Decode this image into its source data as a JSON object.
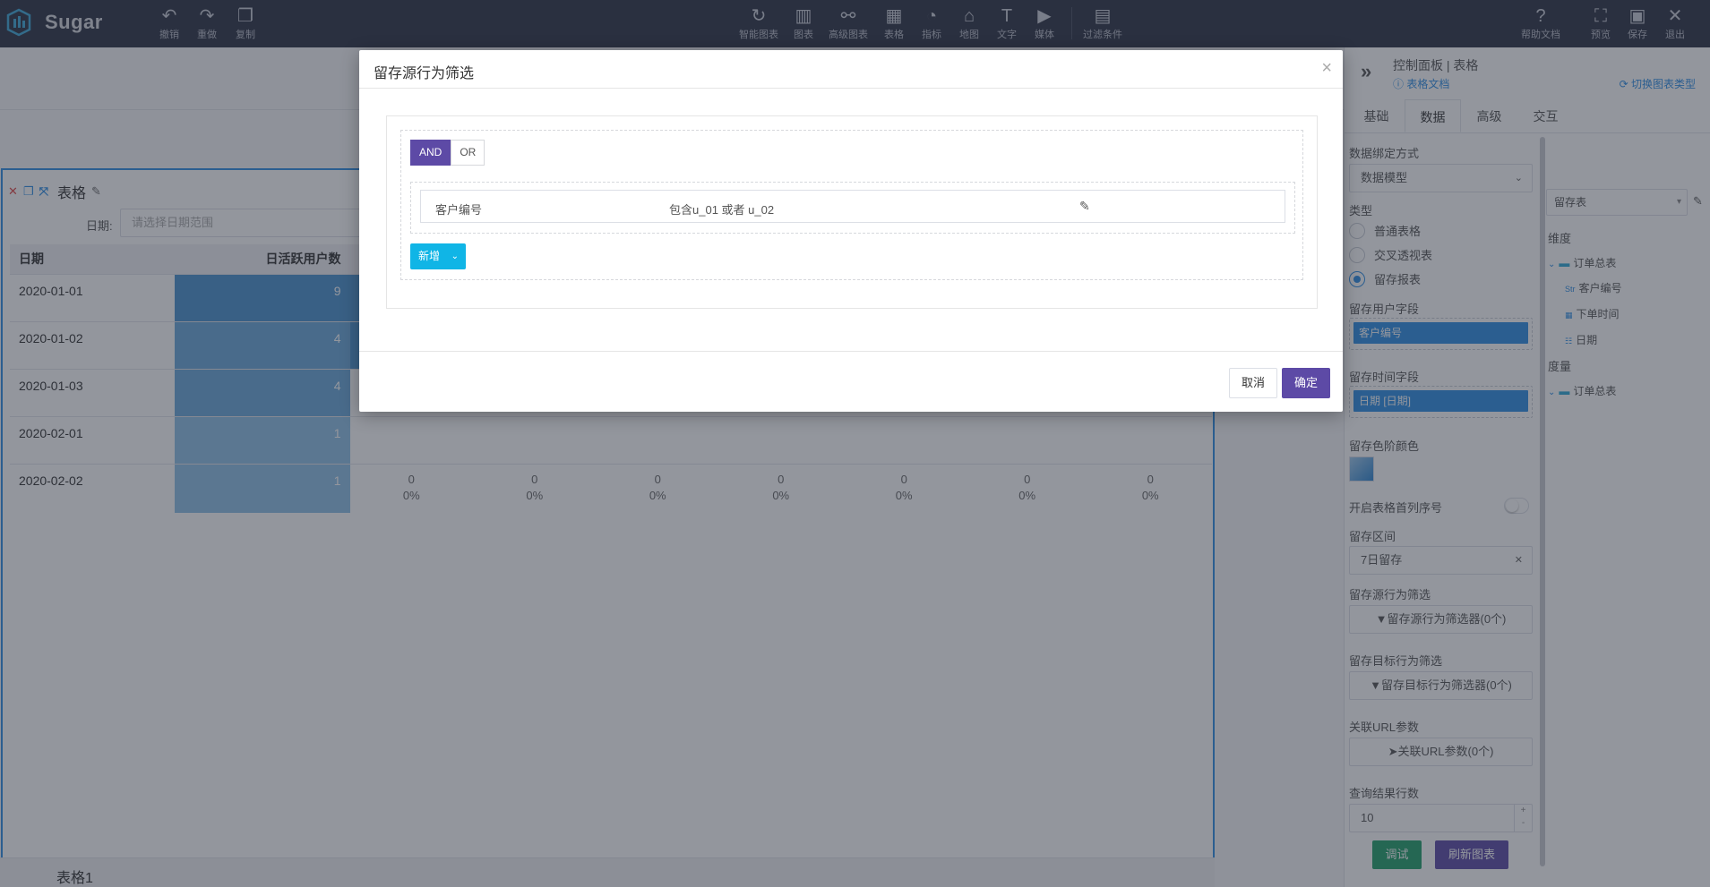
{
  "app": {
    "brand": "Sugar"
  },
  "toolbar": {
    "left": [
      {
        "label": "撤销",
        "icon": "undo-icon"
      },
      {
        "label": "重做",
        "icon": "redo-icon"
      },
      {
        "label": "复制",
        "icon": "copy-icon"
      }
    ],
    "center": [
      {
        "label": "智能图表",
        "icon": "smart-chart-icon"
      },
      {
        "label": "图表",
        "icon": "bar-chart-icon"
      },
      {
        "label": "高级图表",
        "icon": "advanced-chart-icon"
      },
      {
        "label": "表格",
        "icon": "table-icon"
      },
      {
        "label": "指标",
        "icon": "gauge-icon"
      },
      {
        "label": "地图",
        "icon": "map-icon"
      },
      {
        "label": "文字",
        "icon": "text-icon"
      },
      {
        "label": "媒体",
        "icon": "media-icon"
      },
      {
        "label": "过滤条件",
        "icon": "filter-icon"
      }
    ],
    "right": [
      {
        "label": "帮助文档",
        "icon": "help-icon"
      },
      {
        "label": "预览",
        "icon": "preview-icon"
      },
      {
        "label": "保存",
        "icon": "save-icon"
      },
      {
        "label": "退出",
        "icon": "exit-icon"
      }
    ]
  },
  "widget": {
    "title": "表格",
    "date_label": "日期:",
    "date_placeholder": "请选择日期范围",
    "columns": [
      "日期",
      "日活跃用户数"
    ],
    "rows": [
      {
        "date": "2020-01-01",
        "value": "9"
      },
      {
        "date": "2020-01-02",
        "value": "4"
      },
      {
        "date": "2020-01-03",
        "value": "4"
      },
      {
        "date": "2020-02-01",
        "value": "1"
      },
      {
        "date": "2020-02-02",
        "value": "1"
      }
    ],
    "last_row_retention": [
      {
        "count": "0",
        "pct": "0%"
      },
      {
        "count": "0",
        "pct": "0%"
      },
      {
        "count": "0",
        "pct": "0%"
      },
      {
        "count": "0",
        "pct": "0%"
      },
      {
        "count": "0",
        "pct": "0%"
      },
      {
        "count": "0",
        "pct": "0%"
      },
      {
        "count": "0",
        "pct": "0%"
      }
    ],
    "sheet_tab": "表格1"
  },
  "panel": {
    "title": "控制面板 | 表格",
    "doc_link": "表格文档",
    "switch_type": "切换图表类型",
    "tabs": [
      "基础",
      "数据",
      "高级",
      "交互"
    ],
    "active_tab": "数据",
    "binding_label": "数据绑定方式",
    "binding_value": "数据模型",
    "type_label": "类型",
    "types": [
      "普通表格",
      "交叉透视表",
      "留存报表"
    ],
    "selected_type": "留存报表",
    "user_field_label": "留存用户字段",
    "user_field": "客户编号",
    "time_field_label": "留存时间字段",
    "time_field": "日期 [日期]",
    "color_label": "留存色阶颜色",
    "serial_label": "开启表格首列序号",
    "interval_label": "留存区间",
    "interval_value": "7日留存",
    "source_filter_label": "留存源行为筛选",
    "source_filter_btn": "留存源行为筛选器(0个)",
    "target_filter_label": "留存目标行为筛选",
    "target_filter_btn": "留存目标行为筛选器(0个)",
    "url_label": "关联URL参数",
    "url_btn": "关联URL参数(0个)",
    "rows_label": "查询结果行数",
    "rows_value": "10",
    "debug_btn": "调试",
    "refresh_btn": "刷新图表"
  },
  "tree": {
    "table_select": "留存表",
    "dim_label": "维度",
    "dim_folder": "订单总表",
    "dim_fields": [
      {
        "type": "Str",
        "name": "客户编号"
      },
      {
        "type": "date",
        "name": "下单时间"
      },
      {
        "type": "date",
        "name": "日期"
      }
    ],
    "measure_label": "度量",
    "measure_folder": "订单总表"
  },
  "modal": {
    "title": "留存源行为筛选",
    "and_label": "AND",
    "or_label": "OR",
    "logic_selected": "AND",
    "condition": {
      "field": "客户编号",
      "value": "包含u_01 或者 u_02"
    },
    "add_btn": "新增",
    "cancel_btn": "取消",
    "ok_btn": "确定"
  }
}
